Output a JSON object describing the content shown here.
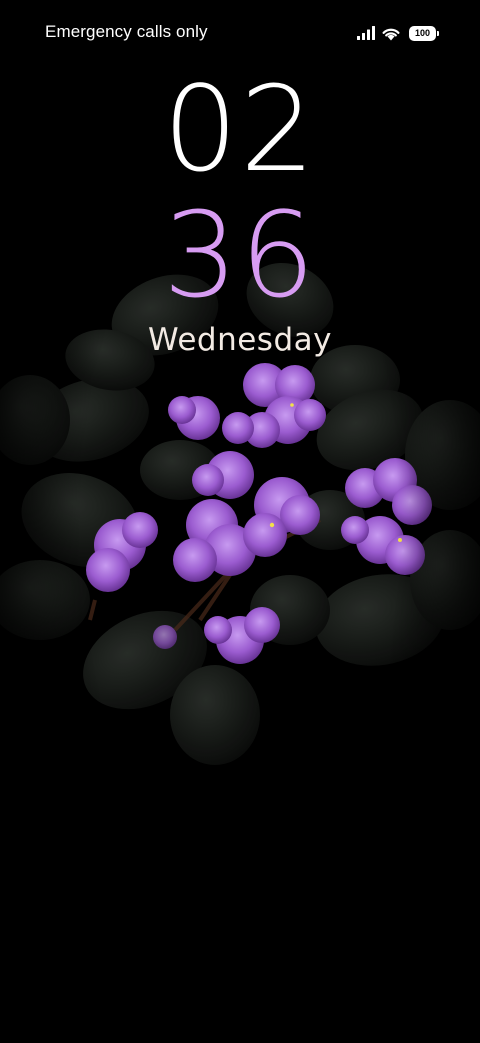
{
  "status_bar": {
    "carrier_text": "Emergency calls only",
    "battery_level": "100",
    "icons": [
      "signal-icon",
      "wifi-icon",
      "battery-icon"
    ]
  },
  "lock_screen": {
    "hours": "02",
    "minutes": "36",
    "weekday": "Wednesday"
  },
  "colors": {
    "background": "#000000",
    "hours": "#ffffff",
    "minutes": "#d79cf2",
    "weekday": "#f3ebe4",
    "flower": "#9b5cd0",
    "leaf": "#1b1f1b"
  }
}
